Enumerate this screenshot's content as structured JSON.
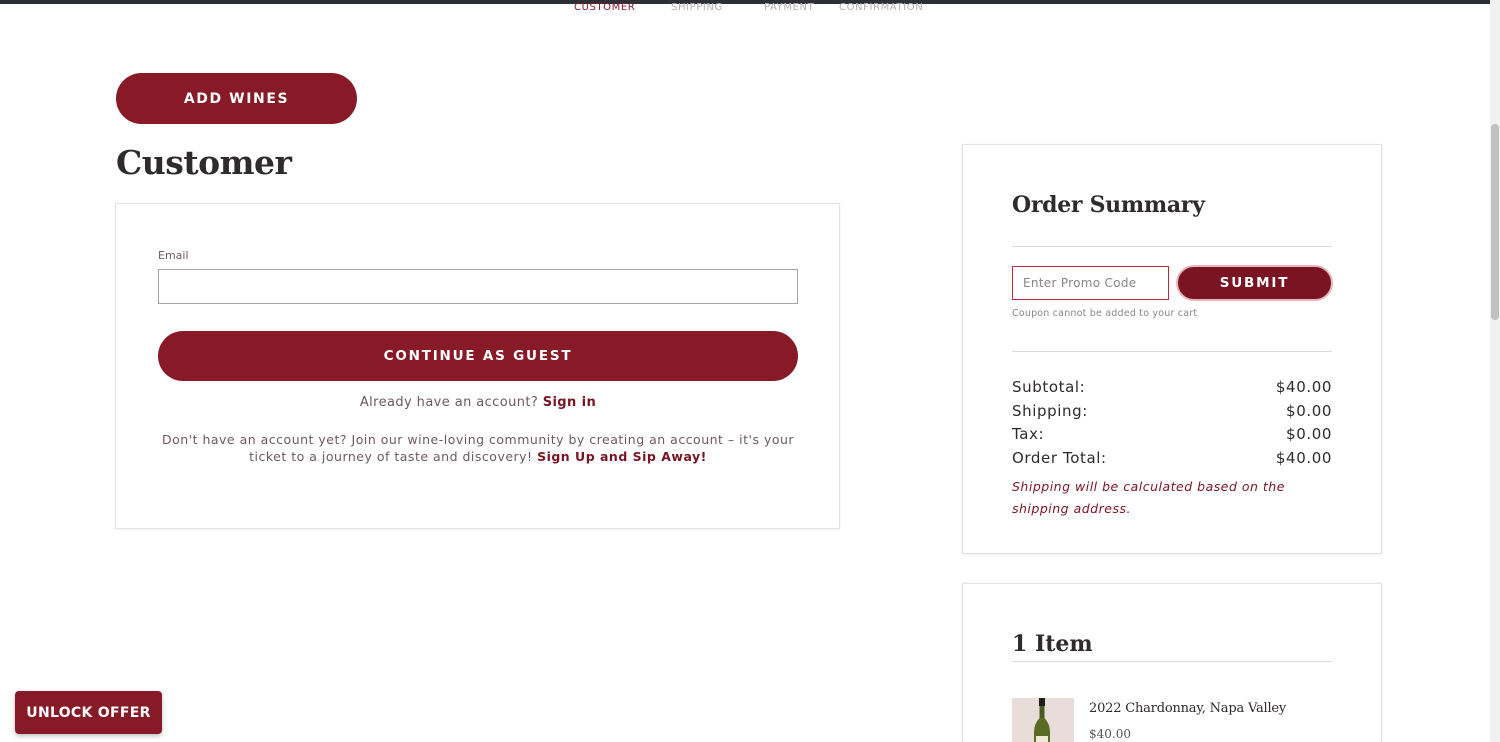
{
  "steps": [
    {
      "label": "CUSTOMER",
      "active": true
    },
    {
      "label": "SHIPPING",
      "active": false
    },
    {
      "label": "PAYMENT",
      "active": false
    },
    {
      "label": "CONFIRMATION",
      "active": false
    }
  ],
  "add_wines_label": "ADD WINES",
  "customer": {
    "title": "Customer",
    "email_label": "Email",
    "email_value": "",
    "continue_label": "CONTINUE AS GUEST",
    "have_account_text": "Already have an account?",
    "sign_in_label": "Sign in",
    "no_account_text": "Don't have an account yet? Join our wine-loving community by creating an account – it's your ticket to a journey of taste and discovery!",
    "signup_label": "Sign Up and Sip Away!"
  },
  "summary": {
    "title": "Order Summary",
    "promo_placeholder": "Enter Promo Code",
    "submit_label": "SUBMIT",
    "coupon_note": "Coupon cannot be added to your cart",
    "rows": [
      {
        "label": "Subtotal:",
        "value": "$40.00"
      },
      {
        "label": "Shipping:",
        "value": "$0.00"
      },
      {
        "label": "Tax:",
        "value": "$0.00"
      },
      {
        "label": "Order Total:",
        "value": "$40.00"
      }
    ],
    "shipping_note": "Shipping will be calculated based on the shipping address."
  },
  "items": {
    "title": "1 Item",
    "list": [
      {
        "name": "2022 Chardonnay, Napa Valley",
        "price": "$40.00",
        "icon": "wine-bottle-image"
      }
    ]
  },
  "unlock_offer_label": "UNLOCK OFFER",
  "colors": {
    "brand": "#871a26",
    "brand_dark": "#7a1423",
    "promo_border": "#c6253a"
  }
}
